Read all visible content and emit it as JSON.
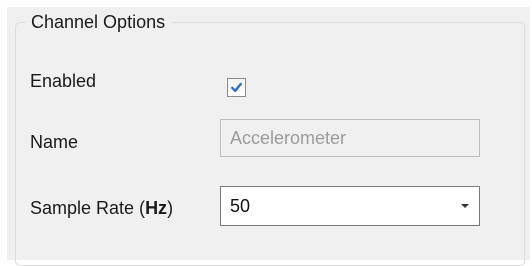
{
  "group": {
    "title": "Channel Options"
  },
  "fields": {
    "enabled": {
      "label": "Enabled",
      "checked": true
    },
    "name": {
      "label": "Name",
      "value": "Accelerometer"
    },
    "sample_rate": {
      "label_prefix": "Sample Rate (",
      "label_unit": "Hz",
      "label_suffix": ")",
      "selected": "50"
    }
  },
  "icons": {
    "checkbox_mark": "check-icon",
    "dropdown": "chevron-down-icon"
  },
  "colors": {
    "panel_background": "#f0f0f0",
    "checkmark": "#2f6fc8",
    "disabled_text": "#9b9b9b"
  }
}
